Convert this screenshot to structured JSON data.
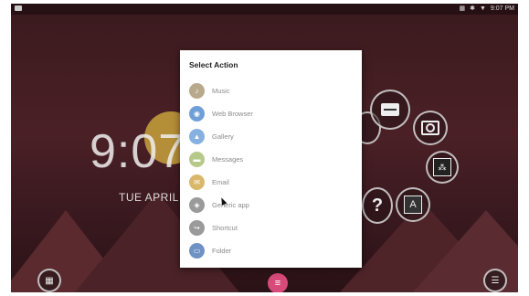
{
  "status_bar": {
    "time": "9:07 PM",
    "icons": [
      "notification-icon",
      "vibrate-icon",
      "bluetooth-icon",
      "wifi-icon"
    ]
  },
  "home": {
    "clock": "9:07",
    "date": "TUE APRIL"
  },
  "dialog": {
    "title": "Select Action",
    "options": [
      {
        "label": "Music",
        "icon": "music-icon",
        "color": "#b9a98c"
      },
      {
        "label": "Web Browser",
        "icon": "globe-icon",
        "color": "#6f9fd6"
      },
      {
        "label": "Gallery",
        "icon": "gallery-icon",
        "color": "#86b0e0"
      },
      {
        "label": "Messages",
        "icon": "messages-icon",
        "color": "#b7c98a"
      },
      {
        "label": "Email",
        "icon": "email-icon",
        "color": "#d9b86a"
      },
      {
        "label": "Generic app",
        "icon": "android-icon",
        "color": "#9a9a9a"
      },
      {
        "label": "Shortcut",
        "icon": "shortcut-icon",
        "color": "#9a9a9a"
      },
      {
        "label": "Folder",
        "icon": "folder-icon",
        "color": "#6f92c4"
      }
    ]
  },
  "ring_icons": [
    "unknown-app-icon",
    "drawer-icon",
    "camera-icon",
    "dropbox-icon",
    "help-icon",
    "font-app-icon"
  ],
  "dock": {
    "left_icon": "apps-icon",
    "center_icon": "menu-icon",
    "right_icon": "settings-icon"
  }
}
